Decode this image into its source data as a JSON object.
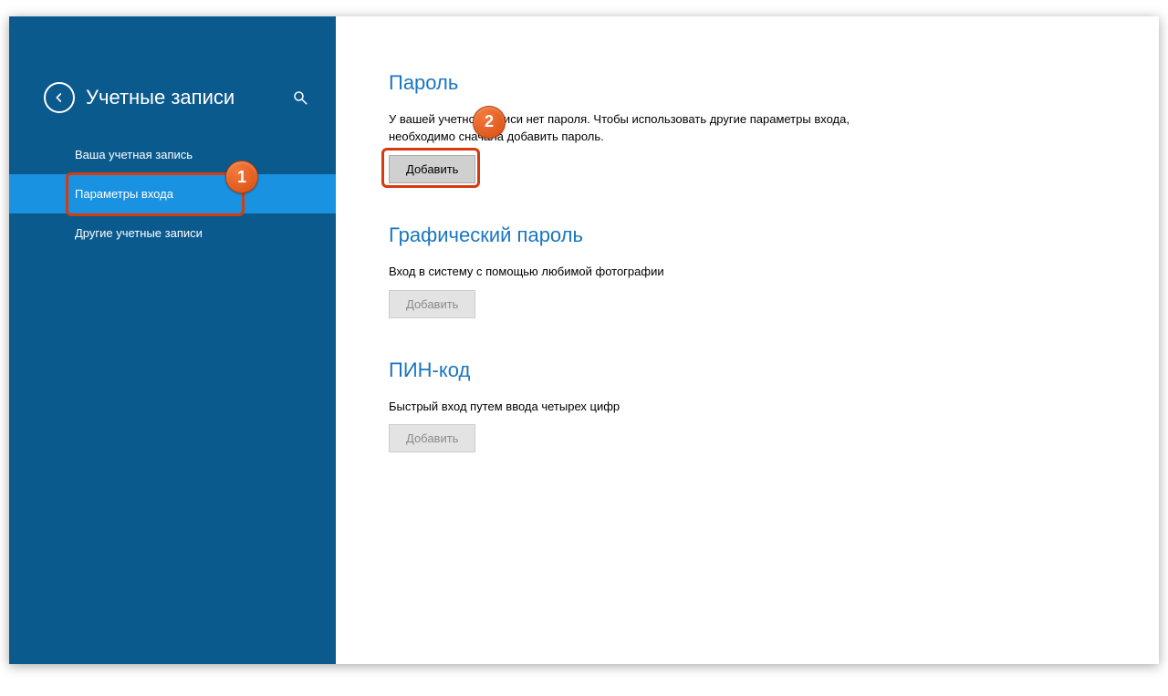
{
  "sidebar": {
    "title": "Учетные записи",
    "items": [
      {
        "label": "Ваша учетная запись"
      },
      {
        "label": "Параметры входа"
      },
      {
        "label": "Другие учетные записи"
      }
    ]
  },
  "sections": {
    "password": {
      "title": "Пароль",
      "description": "У вашей учетной записи нет пароля. Чтобы использовать другие параметры входа, необходимо сначала добавить пароль.",
      "button": "Добавить"
    },
    "picture_password": {
      "title": "Графический пароль",
      "description": "Вход в систему с помощью любимой фотографии",
      "button": "Добавить"
    },
    "pin": {
      "title": "ПИН-код",
      "description": "Быстрый вход путем ввода четырех цифр",
      "button": "Добавить"
    }
  },
  "annotations": {
    "badge1": "1",
    "badge2": "2"
  }
}
